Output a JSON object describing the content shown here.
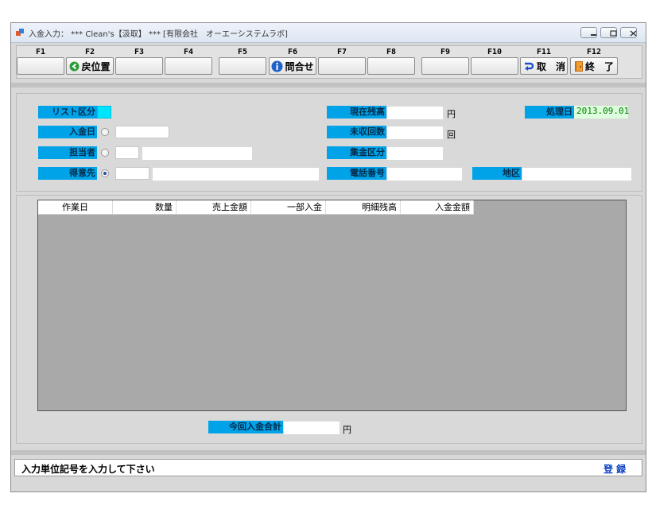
{
  "window": {
    "title": "入金入力： *** Clean's【汲取】 *** [有限会社　オーエーシステムラボ]"
  },
  "fkeys": [
    {
      "key": "F1",
      "label": ""
    },
    {
      "key": "F2",
      "label": "戻位置",
      "icon": "back-arrow-icon"
    },
    {
      "key": "F3",
      "label": ""
    },
    {
      "key": "F4",
      "label": ""
    },
    {
      "key": "F5",
      "label": ""
    },
    {
      "key": "F6",
      "label": "問合せ",
      "icon": "info-icon"
    },
    {
      "key": "F7",
      "label": ""
    },
    {
      "key": "F8",
      "label": ""
    },
    {
      "key": "F9",
      "label": ""
    },
    {
      "key": "F10",
      "label": ""
    },
    {
      "key": "F11",
      "label": "取　消",
      "icon": "undo-arrow-icon"
    },
    {
      "key": "F12",
      "label": "終　了",
      "icon": "exit-door-icon"
    }
  ],
  "form": {
    "list_kubun_label": "リスト区分",
    "nyukinbi_label": "入金日",
    "tantousha_label": "担当者",
    "tokuisaki_label": "得意先",
    "genzai_zandaka_label": "現在残高",
    "mishu_kaisu_label": "未収回数",
    "shukin_kubun_label": "集金区分",
    "denwa_bango_label": "電話番号",
    "chiku_label": "地区",
    "shoribi_label": "処理日",
    "shoribi_value": "2013.09.01",
    "yen_unit": "円",
    "kai_unit": "回",
    "radio_selected": "tokuisaki"
  },
  "grid": {
    "columns": [
      "作業日",
      "数量",
      "売上金額",
      "一部入金",
      "明細残高",
      "入金金額"
    ]
  },
  "footer": {
    "total_label": "今回入金合計",
    "total_unit": "円"
  },
  "status": {
    "message": "入力単位記号を入力して下さい",
    "register_label": "登 録"
  },
  "colors": {
    "label_bg": "#00a2e8",
    "date_bg": "#ddffdd",
    "date_text": "#007a00"
  }
}
